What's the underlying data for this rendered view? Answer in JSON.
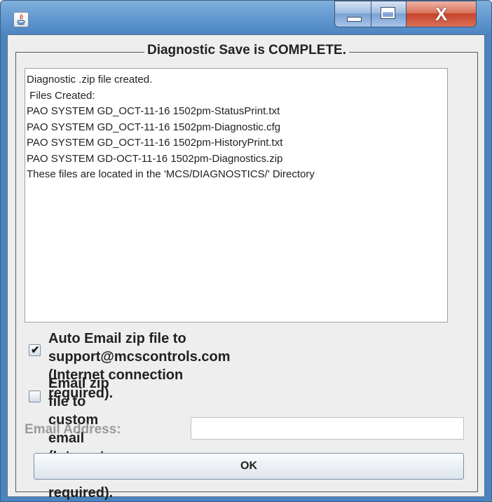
{
  "window": {
    "title": "",
    "controls": {
      "minimize": "_",
      "maximize": "□",
      "close": "X"
    }
  },
  "dialog": {
    "group_title": "Diagnostic Save is COMPLETE.",
    "log_lines": [
      "Diagnostic .zip file created.",
      " Files Created:",
      "PAO SYSTEM GD_OCT-11-16 1502pm-StatusPrint.txt",
      "PAO SYSTEM GD_OCT-11-16 1502pm-Diagnostic.cfg",
      "PAO SYSTEM GD_OCT-11-16 1502pm-HistoryPrint.txt",
      "PAO SYSTEM GD-OCT-11-16 1502pm-Diagnostics.zip",
      "These files are located in the 'MCS/DIAGNOSTICS/' Directory"
    ],
    "auto_email": {
      "checked": true,
      "line1": "Auto Email zip file to support@mcscontrols.com",
      "line2": "(Internet connection required)."
    },
    "custom_email": {
      "checked": false,
      "line1": "Email zip file to custom email (Internet connection",
      "line2": "required)."
    },
    "email_address": {
      "label": "Email Address:",
      "value": "",
      "placeholder": ""
    },
    "ok_label": "OK"
  }
}
